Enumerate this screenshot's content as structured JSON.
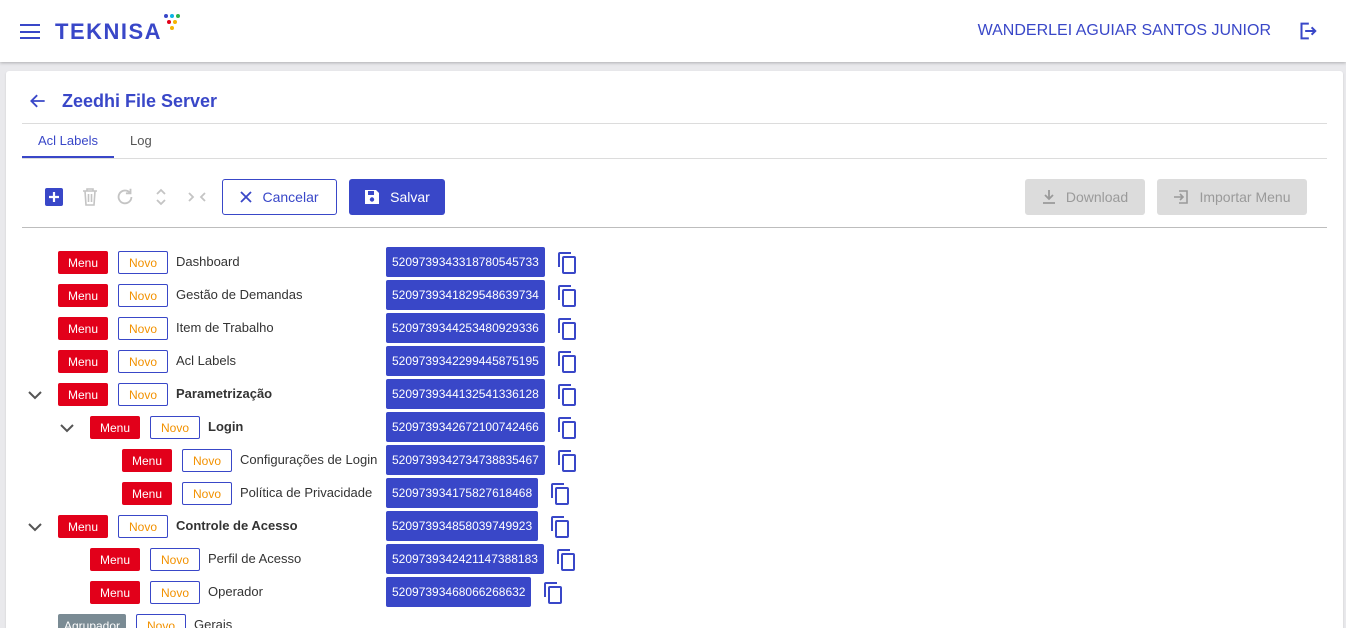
{
  "header": {
    "logo_text": "TEKNISA",
    "logo_dot_colors": [
      "#3947c8",
      "#0cb4e4",
      "#2db34a",
      "#f5b400",
      "#e2001a",
      "#8a2be2"
    ],
    "username": "WANDERLEI AGUIAR SANTOS JUNIOR",
    "icons": {
      "menu": "hamburger-menu-icon",
      "logout": "logout-icon"
    }
  },
  "page": {
    "title": "Zeedhi File Server",
    "back_icon": "arrow-left-icon"
  },
  "tabs": [
    {
      "label": "Acl Labels",
      "active": true
    },
    {
      "label": "Log",
      "active": false
    }
  ],
  "toolbar": {
    "icons": [
      "add-icon",
      "trash-icon",
      "refresh-icon",
      "expand-icon",
      "collapse-icon"
    ],
    "cancel_label": "Cancelar",
    "save_label": "Salvar",
    "download_label": "Download",
    "import_label": "Importar Menu"
  },
  "colors": {
    "primary": "#3947c8",
    "menu_red": "#e2001a",
    "novo_orange": "#f29100",
    "agrupador_gray": "#7a8b94",
    "disabled": "#dcdcdc"
  },
  "tree": [
    {
      "level": 0,
      "expandable": false,
      "type": "Menu",
      "status": "Novo",
      "label": "Dashboard",
      "bold": false,
      "id": "52097393433187805457​33"
    },
    {
      "level": 0,
      "expandable": false,
      "type": "Menu",
      "status": "Novo",
      "label": "Gestão de Demandas",
      "bold": false,
      "id": "52097393418295486397​34"
    },
    {
      "level": 0,
      "expandable": false,
      "type": "Menu",
      "status": "Novo",
      "label": "Item de Trabalho",
      "bold": false,
      "id": "5209739344253480929336"
    },
    {
      "level": 0,
      "expandable": false,
      "type": "Menu",
      "status": "Novo",
      "label": "Acl Labels",
      "bold": false,
      "id": "5209739342299445875195"
    },
    {
      "level": 0,
      "expandable": true,
      "type": "Menu",
      "status": "Novo",
      "label": "Parametrização",
      "bold": true,
      "id": "5209739344132541336128"
    },
    {
      "level": 1,
      "expandable": true,
      "type": "Menu",
      "status": "Novo",
      "label": "Login",
      "bold": true,
      "id": "5209739342672100742466"
    },
    {
      "level": 2,
      "expandable": false,
      "type": "Menu",
      "status": "Novo",
      "label": "Configurações de Login",
      "bold": false,
      "id": "5209739342734738835467"
    },
    {
      "level": 2,
      "expandable": false,
      "type": "Menu",
      "status": "Novo",
      "label": "Política de Privacidade",
      "bold": false,
      "id": "520973934175827618468"
    },
    {
      "level": 0,
      "expandable": true,
      "type": "Menu",
      "status": "Novo",
      "label": "Controle de Acesso",
      "bold": true,
      "id": "520973934858039749923"
    },
    {
      "level": 1,
      "expandable": false,
      "type": "Menu",
      "status": "Novo",
      "label": "Perfil de Acesso",
      "bold": false,
      "id": "5209739342421147388183"
    },
    {
      "level": 1,
      "expandable": false,
      "type": "Menu",
      "status": "Novo",
      "label": "Operador",
      "bold": false,
      "id": "520973934680662686​32"
    },
    {
      "level": 0,
      "expandable": false,
      "type": "Agrupador",
      "status": "Novo",
      "label": "Gerais",
      "bold": false,
      "id": ""
    }
  ]
}
